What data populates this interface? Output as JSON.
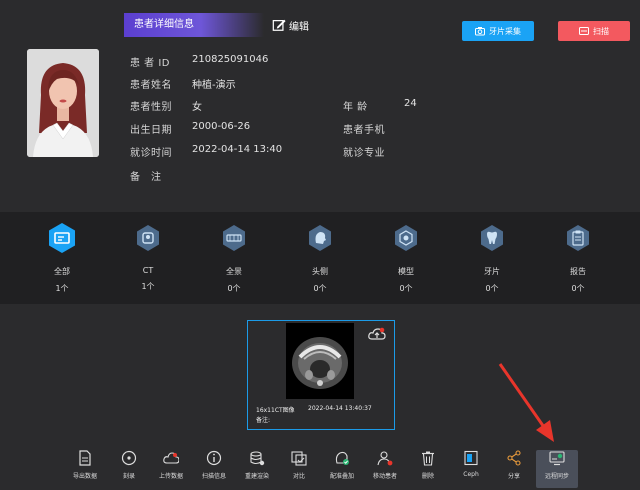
{
  "header": {
    "title": "患者详细信息",
    "edit_label": "编辑",
    "photo_button": "牙片采集",
    "scan_button": "扫描"
  },
  "patient": {
    "id_label": "患 者 ID",
    "id_value": "210825091046",
    "name_label": "患者姓名",
    "name_value": "种植-演示",
    "gender_label": "患者性别",
    "gender_value": "女",
    "age_label": "年 龄",
    "age_value": "24",
    "birth_label": "出生日期",
    "birth_value": "2000-06-26",
    "phone_label": "患者手机",
    "visit_time_label": "就诊时间",
    "visit_time_value": "2022-04-14 13:40",
    "specialty_label": "就诊专业",
    "note_label": "备　注"
  },
  "categories": [
    {
      "label": "全部",
      "count": "1个",
      "icon": "all-icon",
      "active": true
    },
    {
      "label": "CT",
      "count": "1个",
      "icon": "ct-icon"
    },
    {
      "label": "全景",
      "count": "0个",
      "icon": "panorama-icon"
    },
    {
      "label": "头侧",
      "count": "0个",
      "icon": "cephalometric-icon"
    },
    {
      "label": "模型",
      "count": "0个",
      "icon": "model-icon"
    },
    {
      "label": "牙片",
      "count": "0个",
      "icon": "tooth-icon"
    },
    {
      "label": "报告",
      "count": "0个",
      "icon": "report-icon"
    }
  ],
  "image_card": {
    "caption": "16x11CT图像",
    "time": "2022-04-14 13:40:37",
    "note": "备注:"
  },
  "toolbar": [
    {
      "label": "导出数据",
      "icon": "export-icon"
    },
    {
      "label": "刻录",
      "icon": "burn-disc-icon"
    },
    {
      "label": "上传数据",
      "icon": "upload-icon"
    },
    {
      "label": "扫描信息",
      "icon": "scan-info-icon"
    },
    {
      "label": "重建渲染",
      "icon": "rebuild-icon"
    },
    {
      "label": "对比",
      "icon": "compare-icon"
    },
    {
      "label": "配准叠加",
      "icon": "register-overlay-icon"
    },
    {
      "label": "移动患者",
      "icon": "move-patient-icon"
    },
    {
      "label": "删除",
      "icon": "delete-icon"
    },
    {
      "label": "Ceph",
      "icon": "ceph-icon"
    },
    {
      "label": "分享",
      "icon": "share-icon"
    },
    {
      "label": "远程同步",
      "icon": "remote-sync-icon",
      "active": true
    }
  ],
  "colors": {
    "accent_blue": "#1aa3f5",
    "scan_red": "#f3595f",
    "title_purple": "#5b3fd0",
    "active_category": "#1aa3f5",
    "inactive_category": "#4d6b8c",
    "arrow_red": "#e8352b"
  }
}
